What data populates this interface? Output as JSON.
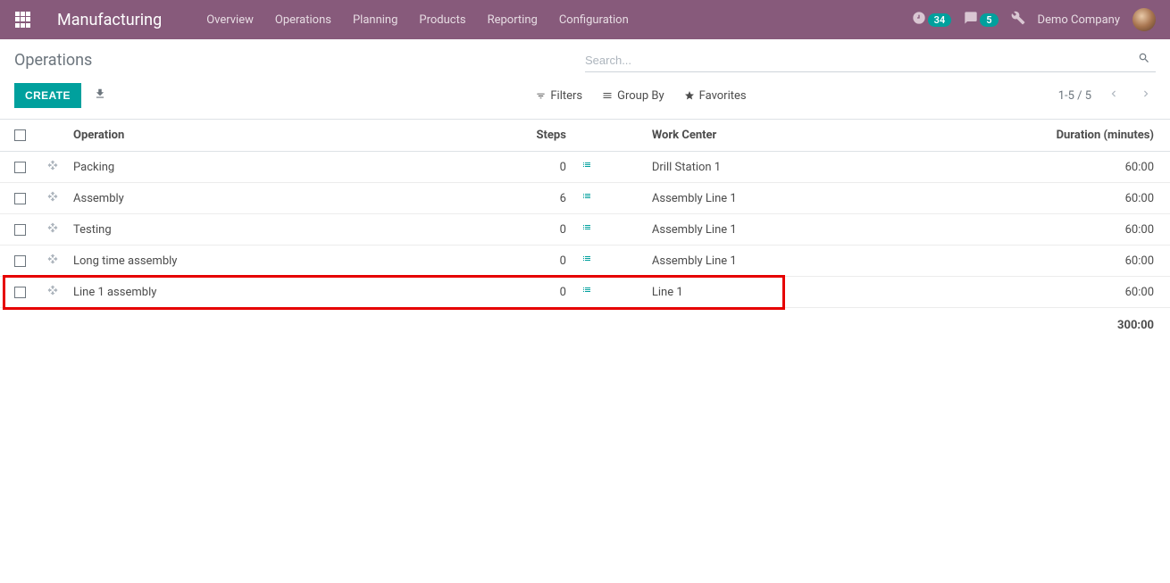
{
  "navbar": {
    "brand": "Manufacturing",
    "menu": [
      "Overview",
      "Operations",
      "Planning",
      "Products",
      "Reporting",
      "Configuration"
    ],
    "activity_badge": "34",
    "messages_badge": "5",
    "company": "Demo Company"
  },
  "control_panel": {
    "breadcrumb": "Operations",
    "search_placeholder": "Search...",
    "create_label": "CREATE",
    "filters_label": "Filters",
    "groupby_label": "Group By",
    "favorites_label": "Favorites",
    "pager": "1-5 / 5"
  },
  "table": {
    "headers": {
      "operation": "Operation",
      "steps": "Steps",
      "work_center": "Work Center",
      "duration": "Duration (minutes)"
    },
    "rows": [
      {
        "operation": "Packing",
        "steps": "0",
        "work_center": "Drill Station 1",
        "duration": "60:00"
      },
      {
        "operation": "Assembly",
        "steps": "6",
        "work_center": "Assembly Line 1",
        "duration": "60:00"
      },
      {
        "operation": "Testing",
        "steps": "0",
        "work_center": "Assembly Line 1",
        "duration": "60:00"
      },
      {
        "operation": "Long time assembly",
        "steps": "0",
        "work_center": "Assembly Line 1",
        "duration": "60:00"
      },
      {
        "operation": "Line 1 assembly",
        "steps": "0",
        "work_center": "Line 1",
        "duration": "60:00"
      }
    ],
    "total_duration": "300:00"
  }
}
